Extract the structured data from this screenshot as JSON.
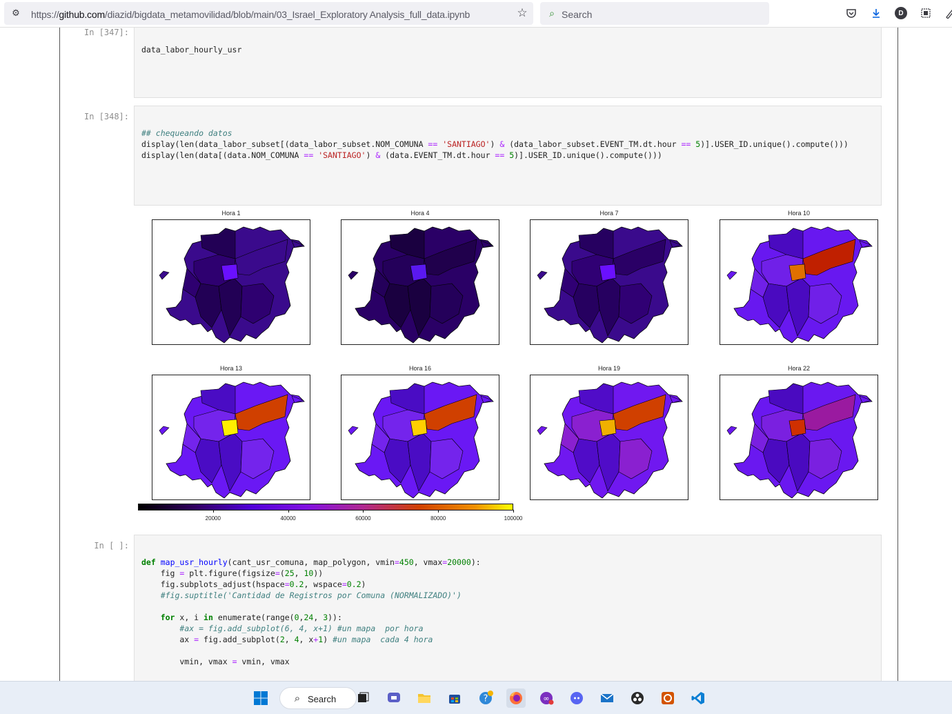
{
  "browser": {
    "url_prefix": "https://",
    "url_host": "github.com",
    "url_path": "/diazid/bigdata_metamovilidad/blob/main/03_Israel_Exploratory Analysis_full_data.ipynb",
    "search_placeholder": "Search",
    "profile_initial": "D"
  },
  "cells": [
    {
      "prompt": "In [347]:",
      "lines": [
        "data_labor_hourly_usr"
      ]
    },
    {
      "prompt": "In [348]:"
    },
    {
      "prompt": "In [ ]:"
    }
  ],
  "figure": {
    "subplot_titles": [
      "Hora 1",
      "Hora 4",
      "Hora 7",
      "Hora 10",
      "Hora 13",
      "Hora 16",
      "Hora 19",
      "Hora 22"
    ],
    "colormap": "gnuplot",
    "colorbar_ticks": [
      "20000",
      "40000",
      "60000",
      "80000",
      "100000"
    ],
    "colorbar_range": [
      0,
      100000
    ]
  },
  "taskbar": {
    "search_label": "Search"
  }
}
